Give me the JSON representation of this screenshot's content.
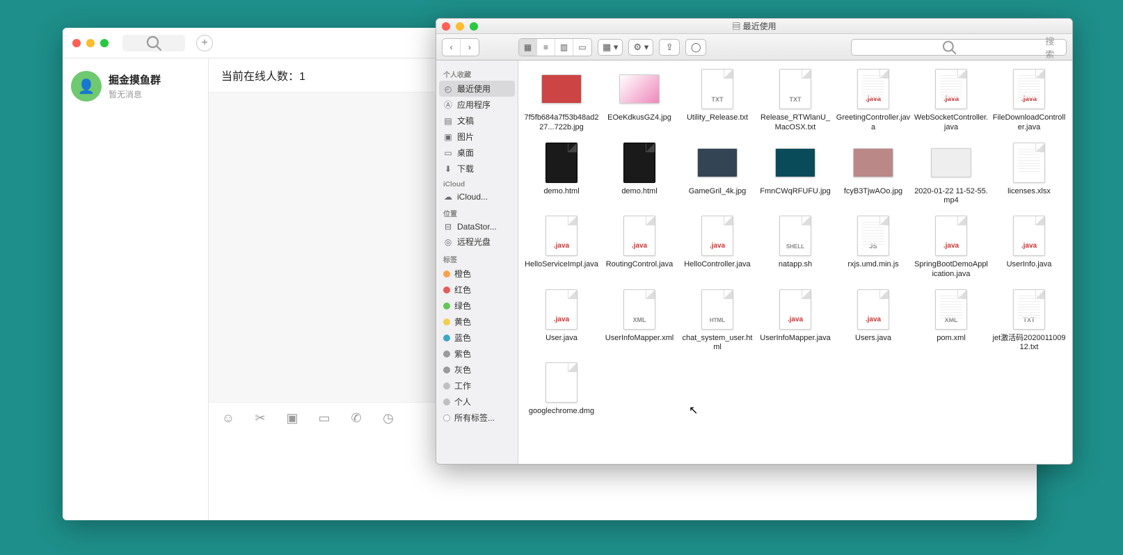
{
  "chat": {
    "search_placeholder": "",
    "item": {
      "name": "掘金摸鱼群",
      "sub": "暂无消息"
    },
    "header": "当前在线人数：1",
    "tools": [
      "emoji",
      "scissors",
      "screenshot",
      "folder",
      "phone",
      "history"
    ]
  },
  "finder": {
    "title": "最近使用",
    "search_placeholder": "搜索",
    "sidebar": {
      "favorites_head": "个人收藏",
      "favorites": [
        {
          "icon": "clock",
          "label": "最近使用",
          "selected": true
        },
        {
          "icon": "apps",
          "label": "应用程序"
        },
        {
          "icon": "doc",
          "label": "文稿"
        },
        {
          "icon": "image",
          "label": "图片"
        },
        {
          "icon": "desktop",
          "label": "桌面"
        },
        {
          "icon": "download",
          "label": "下载"
        }
      ],
      "icloud_head": "iCloud",
      "icloud": [
        {
          "icon": "cloud",
          "label": "iCloud..."
        }
      ],
      "locations_head": "位置",
      "locations": [
        {
          "icon": "disk",
          "label": "DataStor..."
        },
        {
          "icon": "disc",
          "label": "远程光盘"
        }
      ],
      "tags_head": "标签",
      "tags": [
        {
          "color": "#f7a24a",
          "label": "橙色"
        },
        {
          "color": "#e85b5b",
          "label": "红色"
        },
        {
          "color": "#60c654",
          "label": "绿色"
        },
        {
          "color": "#f3cd4d",
          "label": "黄色"
        },
        {
          "color": "#3ea8c6",
          "label": "蓝色"
        },
        {
          "color": "#9a9a9a",
          "label": "紫色"
        },
        {
          "color": "#9a9a9a",
          "label": "灰色"
        },
        {
          "color": "#bfbfbf",
          "label": "工作"
        },
        {
          "color": "#bfbfbf",
          "label": "个人"
        },
        {
          "color": "",
          "label": "所有标签..."
        }
      ]
    },
    "files": [
      {
        "type": "thumb",
        "bg": "#c44",
        "label": "7f5fb684a7f53b48ad227...722b.jpg"
      },
      {
        "type": "thumb",
        "bg": "linear-gradient(135deg,#fff,#e8b)",
        "label": "EOeKdkusGZ4.jpg"
      },
      {
        "type": "doc",
        "ext": "TXT",
        "extcls": "txt",
        "label": "Utility_Release.txt"
      },
      {
        "type": "doc",
        "ext": "TXT",
        "extcls": "txt",
        "label": "Release_RTWlanU_MacOSX.txt"
      },
      {
        "type": "doc",
        "ext": ".java",
        "extcls": "",
        "lines": true,
        "label": "GreetingController.java"
      },
      {
        "type": "doc",
        "ext": ".java",
        "extcls": "",
        "lines": true,
        "label": "WebSocketController.java"
      },
      {
        "type": "doc",
        "ext": ".java",
        "extcls": "",
        "lines": true,
        "label": "FileDownloadController.java"
      },
      {
        "type": "doc",
        "dark": true,
        "ext": "",
        "label": "demo.html"
      },
      {
        "type": "doc",
        "dark": true,
        "ext": "",
        "label": "demo.html"
      },
      {
        "type": "thumb",
        "bg": "#345",
        "label": "GameGril_4k.jpg"
      },
      {
        "type": "thumb",
        "bg": "#0a4b5a",
        "label": "FmnCWqRFUFU.jpg"
      },
      {
        "type": "thumb",
        "bg": "#b88",
        "label": "fcyB3TjwAOo.jpg"
      },
      {
        "type": "thumb",
        "bg": "#eee",
        "label": "2020-01-22 11-52-55.mp4"
      },
      {
        "type": "doc",
        "ext": "",
        "lines": true,
        "label": "licenses.xlsx"
      },
      {
        "type": "doc",
        "ext": ".java",
        "extcls": "",
        "label": "HelloServiceImpl.java"
      },
      {
        "type": "doc",
        "ext": ".java",
        "extcls": "",
        "label": "RoutingControl.java"
      },
      {
        "type": "doc",
        "ext": ".java",
        "extcls": "",
        "label": "HelloController.java"
      },
      {
        "type": "doc",
        "ext": "SHELL",
        "extcls": "shell",
        "label": "natapp.sh"
      },
      {
        "type": "doc",
        "ext": "JS",
        "extcls": "js",
        "lines": true,
        "label": "rxjs.umd.min.js"
      },
      {
        "type": "doc",
        "ext": ".java",
        "extcls": "",
        "label": "SpringBootDemoApplication.java"
      },
      {
        "type": "doc",
        "ext": ".java",
        "extcls": "",
        "label": "UserInfo.java"
      },
      {
        "type": "doc",
        "ext": ".java",
        "extcls": "",
        "label": "User.java"
      },
      {
        "type": "doc",
        "ext": "XML",
        "extcls": "xml",
        "label": "UserInfoMapper.xml"
      },
      {
        "type": "doc",
        "ext": "HTML",
        "extcls": "html",
        "label": "chat_system_user.html"
      },
      {
        "type": "doc",
        "ext": ".java",
        "extcls": "",
        "label": "UserInfoMapper.java"
      },
      {
        "type": "doc",
        "ext": ".java",
        "extcls": "",
        "label": "Users.java"
      },
      {
        "type": "doc",
        "ext": "XML",
        "extcls": "xml",
        "lines": true,
        "label": "pom.xml"
      },
      {
        "type": "doc",
        "ext": "TXT",
        "extcls": "txt",
        "lines": true,
        "label": "jet激活码202001100912.txt"
      },
      {
        "type": "doc",
        "ext": "",
        "label": "googlechrome.dmg"
      }
    ]
  }
}
